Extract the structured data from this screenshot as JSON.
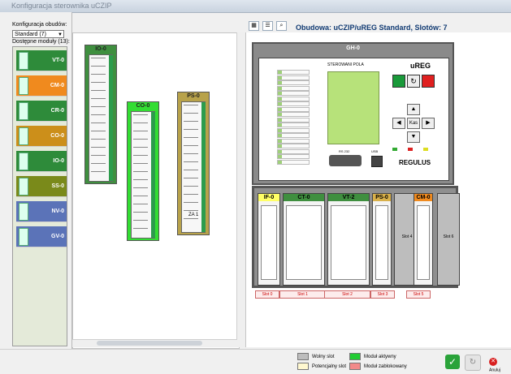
{
  "window": {
    "title": "Konfiguracja sterownika uCZIP"
  },
  "left": {
    "config_label": "Konfiguracja obudów:",
    "config_value": "Standard (7)",
    "modules_label": "Dostępne moduły (13):",
    "modules": [
      {
        "name": "VT-0",
        "color": "#2e8b3a"
      },
      {
        "name": "CM-0",
        "color": "#f08a1e"
      },
      {
        "name": "CR-0",
        "color": "#2e8b3a"
      },
      {
        "name": "CO-0",
        "color": "#cc8f1a"
      },
      {
        "name": "IO-0",
        "color": "#2e8b3a"
      },
      {
        "name": "SS-0",
        "color": "#7a8a1a"
      },
      {
        "name": "NV-0",
        "color": "#5b73b8"
      },
      {
        "name": "GV-0",
        "color": "#5b73b8"
      }
    ]
  },
  "canvas": {
    "cards": [
      {
        "name": "IO-0",
        "color": "#3f8f3f"
      },
      {
        "name": "CO-0",
        "color": "#33dd33"
      },
      {
        "name": "PS-0",
        "color": "#b8a24a"
      }
    ],
    "ps_label": "ZA 1"
  },
  "right": {
    "title": "Obudowa: uCZIP/uREG Standard, Slotów: 7",
    "gh": {
      "name": "GH-0",
      "panel_text": "STEROWANI POLA",
      "brand": "uREG",
      "key_label": "Kas",
      "port_label": "RS 232",
      "usb_label": "USB",
      "logo": "REGULUS"
    },
    "slots": [
      {
        "name": "IF-0",
        "color": "#ffff66"
      },
      {
        "name": "CT-0",
        "color": "#3f8f3f"
      },
      {
        "name": "VT-2",
        "color": "#3f8f3f"
      },
      {
        "name": "PS-0",
        "color": "#d8b04a"
      },
      {
        "name": "Slot 4",
        "color": ""
      },
      {
        "name": "CM-0",
        "color": "#f08a1e"
      },
      {
        "name": "Slot 6",
        "color": ""
      }
    ],
    "slot_labels": [
      "Slot 0",
      "Slot 1",
      "Slot 2",
      "Slot 3",
      "Slot 5"
    ]
  },
  "legend": [
    {
      "label": "Wolny slot",
      "color": "#bdbdbd"
    },
    {
      "label": "Moduł aktywny",
      "color": "#22cc33"
    },
    {
      "label": "Potencjalny slot",
      "color": "#fff8d0"
    },
    {
      "label": "Moduł zablokowany",
      "color": "#f28a8a"
    }
  ],
  "buttons": {
    "ok": "✓",
    "cancel": "Anuluj"
  }
}
